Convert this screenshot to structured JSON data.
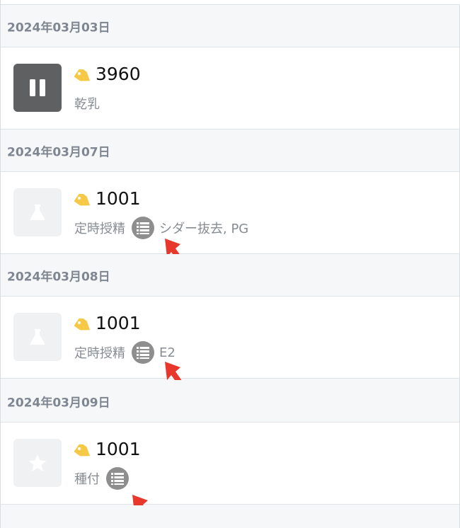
{
  "sections": [
    {
      "date": "2024年03月03日",
      "entry": {
        "tag_id": "3960",
        "event_label": "乾乳",
        "thumbnail_icon": "pause-icon",
        "has_detail": false,
        "detail_text": ""
      }
    },
    {
      "date": "2024年03月07日",
      "entry": {
        "tag_id": "1001",
        "event_label": "定時授精",
        "thumbnail_icon": "flask-icon",
        "has_detail": true,
        "detail_text": "シダー抜去, PG"
      }
    },
    {
      "date": "2024年03月08日",
      "entry": {
        "tag_id": "1001",
        "event_label": "定時授精",
        "thumbnail_icon": "flask-icon",
        "has_detail": true,
        "detail_text": "E2"
      }
    },
    {
      "date": "2024年03月09日",
      "entry": {
        "tag_id": "1001",
        "event_label": "種付",
        "thumbnail_icon": "star-icon",
        "has_detail": true,
        "detail_text": ""
      }
    }
  ],
  "colors": {
    "tag_yellow": "#f5c945",
    "arrow_red": "#e8372c",
    "list_icon_gray": "#8e8e8e",
    "dark_thumb": "#5f6062",
    "light_thumb": "#f0f1f2"
  }
}
